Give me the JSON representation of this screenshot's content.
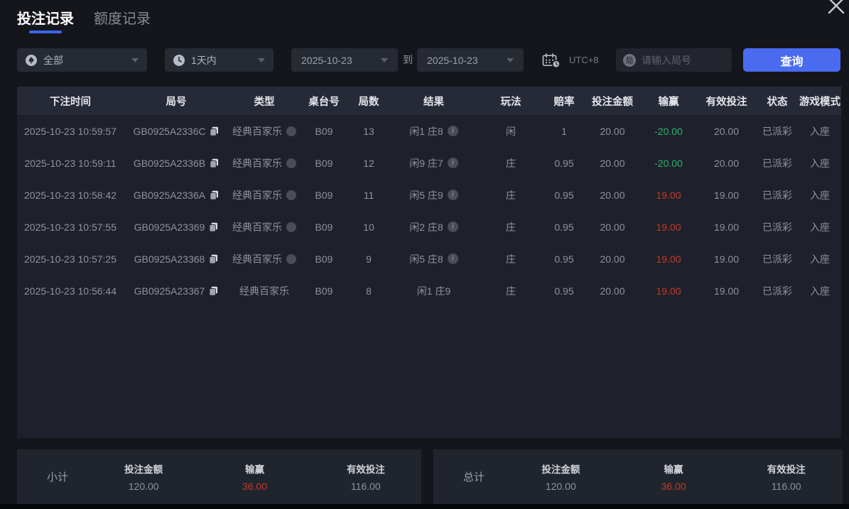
{
  "colors": {
    "accent": "#4a6bf0",
    "green": "#2bb46a",
    "red": "#c43a2c"
  },
  "window": {
    "close_icon": "x"
  },
  "tabs": [
    {
      "label": "投注记录",
      "active": true
    },
    {
      "label": "额度记录",
      "active": false
    }
  ],
  "filters": {
    "category": {
      "value": "全部",
      "icon": "spade"
    },
    "time_range": {
      "value": "1天内",
      "icon": "clock"
    },
    "date_from": "2025-10-23",
    "to_label": "到",
    "date_to": "2025-10-23",
    "timezone": "UTC+8",
    "search_icon_char": "局",
    "search_placeholder": "请输入局号",
    "query_button": "查询"
  },
  "table": {
    "columns": [
      "下注时间",
      "局号",
      "类型",
      "桌台号",
      "局数",
      "结果",
      "玩法",
      "赔率",
      "投注金额",
      "输赢",
      "有效投注",
      "状态",
      "游戏模式"
    ],
    "rows": [
      {
        "time": "2025-10-23 10:59:57",
        "game_id": "GB0925A2336C",
        "type": "经典百家乐",
        "has_type_icon": true,
        "table_no": "B09",
        "rounds": "13",
        "result": "闲1 庄8",
        "has_info": true,
        "play": "闲",
        "odds": "1",
        "bet": "20.00",
        "win_loss": "-20.00",
        "win_loss_color": "green",
        "valid_bet": "20.00",
        "status": "已派彩",
        "mode": "入座"
      },
      {
        "time": "2025-10-23 10:59:11",
        "game_id": "GB0925A2336B",
        "type": "经典百家乐",
        "has_type_icon": true,
        "table_no": "B09",
        "rounds": "12",
        "result": "闲9 庄7",
        "has_info": true,
        "play": "庄",
        "odds": "0.95",
        "bet": "20.00",
        "win_loss": "-20.00",
        "win_loss_color": "green",
        "valid_bet": "20.00",
        "status": "已派彩",
        "mode": "入座"
      },
      {
        "time": "2025-10-23 10:58:42",
        "game_id": "GB0925A2336A",
        "type": "经典百家乐",
        "has_type_icon": true,
        "table_no": "B09",
        "rounds": "11",
        "result": "闲5 庄9",
        "has_info": true,
        "play": "庄",
        "odds": "0.95",
        "bet": "20.00",
        "win_loss": "19.00",
        "win_loss_color": "red",
        "valid_bet": "19.00",
        "status": "已派彩",
        "mode": "入座"
      },
      {
        "time": "2025-10-23 10:57:55",
        "game_id": "GB0925A23369",
        "type": "经典百家乐",
        "has_type_icon": true,
        "table_no": "B09",
        "rounds": "10",
        "result": "闲2 庄8",
        "has_info": true,
        "play": "庄",
        "odds": "0.95",
        "bet": "20.00",
        "win_loss": "19.00",
        "win_loss_color": "red",
        "valid_bet": "19.00",
        "status": "已派彩",
        "mode": "入座"
      },
      {
        "time": "2025-10-23 10:57:25",
        "game_id": "GB0925A23368",
        "type": "经典百家乐",
        "has_type_icon": true,
        "table_no": "B09",
        "rounds": "9",
        "result": "闲5 庄8",
        "has_info": true,
        "play": "庄",
        "odds": "0.95",
        "bet": "20.00",
        "win_loss": "19.00",
        "win_loss_color": "red",
        "valid_bet": "19.00",
        "status": "已派彩",
        "mode": "入座"
      },
      {
        "time": "2025-10-23 10:56:44",
        "game_id": "GB0925A23367",
        "type": "经典百家乐",
        "has_type_icon": false,
        "table_no": "B09",
        "rounds": "8",
        "result": "闲1 庄9",
        "has_info": false,
        "play": "庄",
        "odds": "0.95",
        "bet": "20.00",
        "win_loss": "19.00",
        "win_loss_color": "red",
        "valid_bet": "19.00",
        "status": "已派彩",
        "mode": "入座"
      }
    ]
  },
  "summary": {
    "subtotal": {
      "title": "小计",
      "items": [
        {
          "label": "投注金额",
          "value": "120.00"
        },
        {
          "label": "输赢",
          "value": "36.00",
          "color": "red"
        },
        {
          "label": "有效投注",
          "value": "116.00"
        }
      ]
    },
    "total": {
      "title": "总计",
      "items": [
        {
          "label": "投注金额",
          "value": "120.00"
        },
        {
          "label": "输赢",
          "value": "36.00",
          "color": "red"
        },
        {
          "label": "有效投注",
          "value": "116.00"
        }
      ]
    }
  }
}
